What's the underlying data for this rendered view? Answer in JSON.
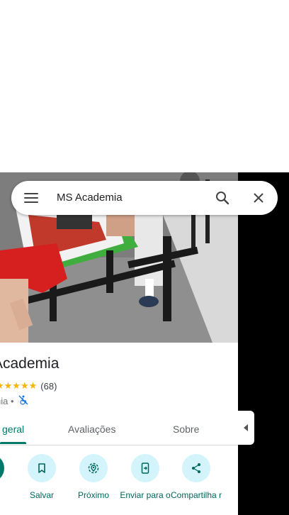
{
  "search": {
    "query": "MS Academia"
  },
  "place": {
    "title": "Academia",
    "stars": "★★★★★",
    "review_count": "(68)",
    "category": "nia •"
  },
  "tabs": [
    {
      "label": "geral",
      "active": true
    },
    {
      "label": "Avaliações",
      "active": false
    },
    {
      "label": "Sobre",
      "active": false
    }
  ],
  "actions": [
    {
      "label": "s",
      "icon": "directions-icon"
    },
    {
      "label": "Salvar",
      "icon": "bookmark-icon"
    },
    {
      "label": "Próximo",
      "icon": "nearby-icon"
    },
    {
      "label": "Enviar para o",
      "icon": "send-to-phone-icon"
    },
    {
      "label": "Compartilha r",
      "icon": "share-icon"
    }
  ],
  "colors": {
    "accent": "#00796b",
    "chip_bg": "#d2f4fa",
    "star": "#f5b400"
  }
}
